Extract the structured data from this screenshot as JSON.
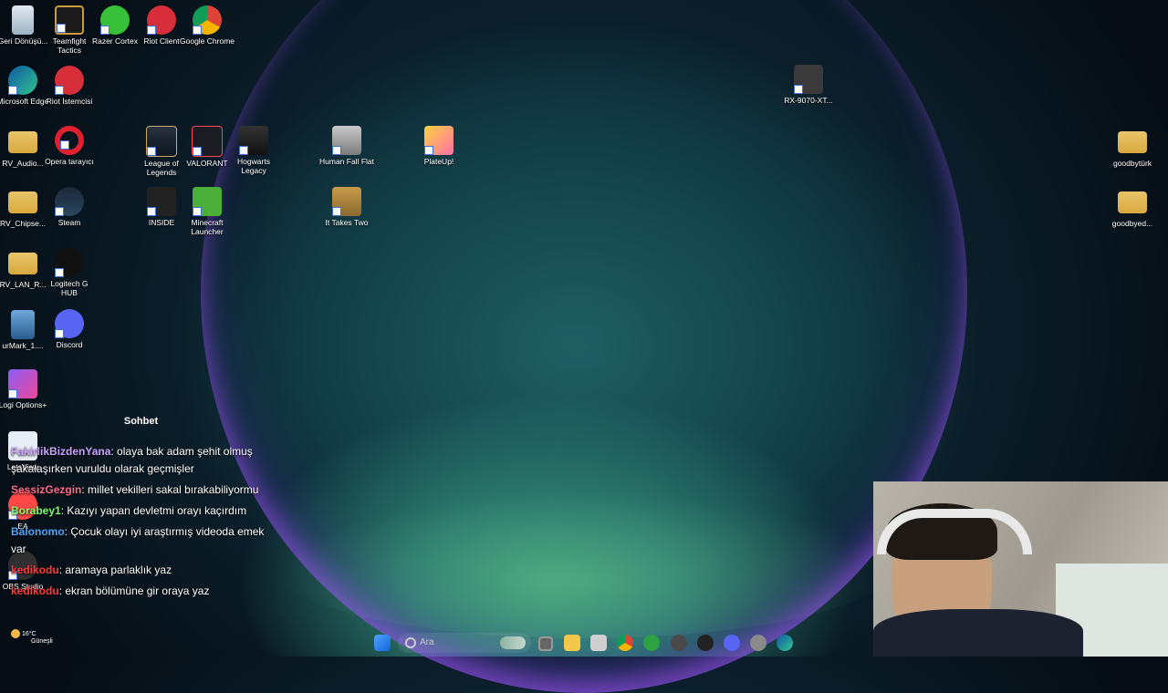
{
  "desktop_icons": [
    {
      "label": "Geri Dönüşü...",
      "icon": "recycle-bin-icon"
    },
    {
      "label": "Teamfight Tactics",
      "icon": "tft-icon"
    },
    {
      "label": "Razer Cortex",
      "icon": "razer-cortex-icon"
    },
    {
      "label": "Riot Client",
      "icon": "riot-client-icon"
    },
    {
      "label": "Google Chrome",
      "icon": "chrome-icon"
    },
    {
      "label": "Microsoft Edge",
      "icon": "edge-icon"
    },
    {
      "label": "Riot İstemcisi",
      "icon": "riot-client-icon"
    },
    {
      "label": "RV_Audio...",
      "icon": "folder-icon"
    },
    {
      "label": "Opera tarayıcı",
      "icon": "opera-icon"
    },
    {
      "label": "League of Legends",
      "icon": "lol-icon"
    },
    {
      "label": "VALORANT",
      "icon": "valorant-icon"
    },
    {
      "label": "Hogwarts Legacy",
      "icon": "hogwarts-icon"
    },
    {
      "label": "Human Fall Flat",
      "icon": "human-fall-flat-icon"
    },
    {
      "label": "PlateUp!",
      "icon": "plateup-icon"
    },
    {
      "label": "RV_Chipse...",
      "icon": "folder-icon"
    },
    {
      "label": "Steam",
      "icon": "steam-icon"
    },
    {
      "label": "INSIDE",
      "icon": "inside-icon"
    },
    {
      "label": "Minecraft Launcher",
      "icon": "minecraft-icon"
    },
    {
      "label": "It Takes Two",
      "icon": "it-takes-two-icon"
    },
    {
      "label": "RV_LAN_R...",
      "icon": "folder-icon"
    },
    {
      "label": "Logitech G HUB",
      "icon": "logitech-icon"
    },
    {
      "label": "urMark_1....",
      "icon": "download-icon"
    },
    {
      "label": "Discord",
      "icon": "discord-icon"
    },
    {
      "label": "Logi Options+",
      "icon": "logi-options-icon"
    },
    {
      "label": "LetsView",
      "icon": "letsview-icon"
    },
    {
      "label": "EA",
      "icon": "ea-icon"
    },
    {
      "label": "OBS Studio",
      "icon": "obs-icon"
    },
    {
      "label": "RX-9070-XT...",
      "icon": "amd-icon"
    },
    {
      "label": "goodbytürk",
      "icon": "folder-icon"
    },
    {
      "label": "goodbyed...",
      "icon": "folder-icon"
    }
  ],
  "chat": {
    "title": "Sohbet",
    "messages": [
      {
        "user": "FakirlikBizdenYana",
        "color": "#c9a3ff",
        "text": ": olaya bak adam şehit olmuş şakalaşırken vuruldu olarak geçmişler"
      },
      {
        "user": "SessizGezgin",
        "color": "#ff6b8a",
        "text": ": millet vekilleri sakal bırakabiliyormu"
      },
      {
        "user": "Borabey1",
        "color": "#7dff6b",
        "text": ": Kazıyı yapan devletmi orayı kaçırdım"
      },
      {
        "user": "Balonomo",
        "color": "#4aa8ff",
        "text": ": Çocuk olayı iyi araştırmış videoda emek var"
      },
      {
        "user": "kedikodu",
        "color": "#ff3b3b",
        "text": ": aramaya parlaklık yaz"
      },
      {
        "user": "kedikodu",
        "color": "#ff3b3b",
        "text": ": ekran bölümüne gir oraya yaz"
      }
    ]
  },
  "taskbar": {
    "search_placeholder": "Ara"
  },
  "weather": {
    "temp": "16°C",
    "desc": "Güneşli"
  }
}
